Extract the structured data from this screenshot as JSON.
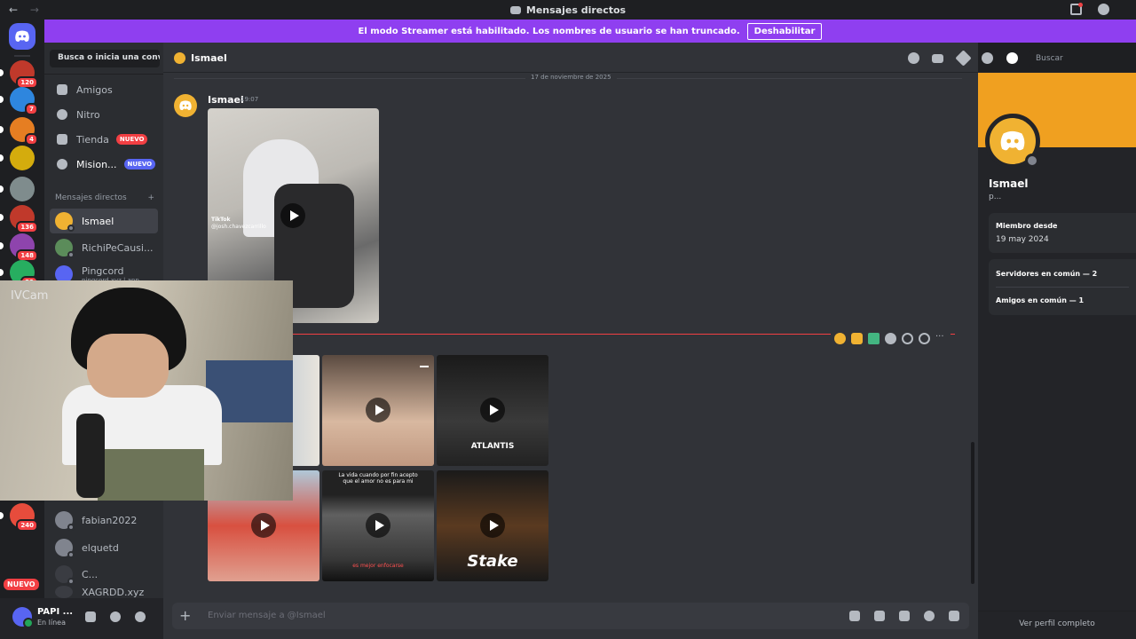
{
  "window": {
    "title": "Mensajes directos"
  },
  "banner": {
    "text": "El modo Streamer está habilitado. Los nombres de usuario se han truncado.",
    "button": "Deshabilitar"
  },
  "servers": [
    {
      "badge": "120",
      "color": "#c0392b"
    },
    {
      "badge": "7",
      "color": "#2e86de"
    },
    {
      "badge": "4",
      "color": "#e67e22"
    },
    {
      "badge": "",
      "color": "#d4ac0d"
    },
    {
      "badge": "",
      "color": "#7f8c8d"
    },
    {
      "badge": "136",
      "color": "#c0392b"
    },
    {
      "badge": "148",
      "color": "#8e44ad"
    },
    {
      "badge": "29",
      "color": "#27ae60"
    },
    {
      "badge": "240",
      "color": "#e74c3c"
    }
  ],
  "rail": {
    "new_badge": "NUEVO"
  },
  "sidebar": {
    "search": "Busca o inicia una conv...",
    "nav": [
      {
        "label": "Amigos",
        "badge": ""
      },
      {
        "label": "Nitro",
        "badge": ""
      },
      {
        "label": "Tienda",
        "badge": "NUEVO"
      },
      {
        "label": "Mision...",
        "badge": "NUEVO"
      }
    ],
    "dm_header": "Mensajes directos",
    "dms": [
      {
        "name": "Ismael",
        "sub": ""
      },
      {
        "name": "RichiPeCausi...",
        "sub": ""
      },
      {
        "name": "Pingcord",
        "sub": "pingcord.xyz | app..."
      },
      {
        "name": "fabian2022",
        "sub": ""
      },
      {
        "name": "elquetd",
        "sub": ""
      },
      {
        "name": "C...",
        "sub": ""
      },
      {
        "name": "XAGRDD.xyz",
        "sub": ""
      }
    ]
  },
  "user": {
    "name": "PAPI ...",
    "status": "En línea"
  },
  "channel": {
    "name": "Ismael",
    "search_placeholder": "Buscar"
  },
  "messages": {
    "date": "17 de noviembre de 2025",
    "author": "Ismael",
    "time": "19:07",
    "video_watermark": "TikTok",
    "video_handle": "@josh.chavezcarrillo"
  },
  "grid_captions": {
    "tile5": "La vida cuando por fin acepto que el amor no es para mi",
    "tile5_bottom": "es mejor enfocarse",
    "tile6": "Stake",
    "tile3": "ATLANTIS"
  },
  "composer": {
    "placeholder": "Enviar mensaje a @Ismael"
  },
  "profile": {
    "name": "Ismael",
    "handle": "p...",
    "member_since_label": "Miembro desde",
    "member_since": "19 may 2024",
    "mutual_servers": "Servidores en común — 2",
    "mutual_friends": "Amigos en común — 1",
    "view_full": "Ver perfil completo"
  },
  "overlay": {
    "cam_label": "IVCam"
  },
  "colors": {
    "blurple": "#5865f2",
    "streamer_banner": "#8f3ff0",
    "mention_red": "#f23f43",
    "avatar_yellow": "#f0b232"
  }
}
